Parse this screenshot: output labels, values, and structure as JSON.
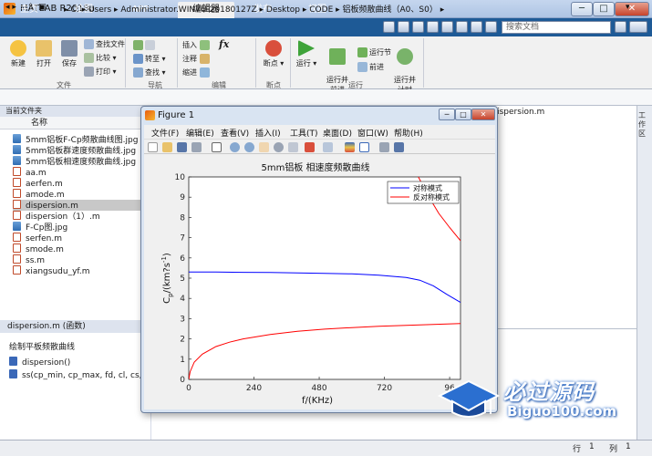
{
  "app": {
    "title": "MATLAB R2018a",
    "window_controls": {
      "minimize": "─",
      "maximize": "□",
      "close": "✕"
    }
  },
  "tabs": [
    "主页",
    "绘图",
    "APP",
    "编辑器",
    "发布",
    "视图"
  ],
  "active_tab": "编辑器",
  "search": {
    "placeholder": "搜索文档"
  },
  "ribbon": {
    "file_group": {
      "label": "文件",
      "new": "新建",
      "open": "打开",
      "save": "保存",
      "find_files": "查找文件",
      "compare": "比较",
      "print": "打印"
    },
    "nav_group": {
      "label": "导航",
      "goto": "转至",
      "find": "查找"
    },
    "edit_group": {
      "label": "编辑",
      "insert": "插入",
      "comment": "注释",
      "indent": "缩进",
      "fx": "fx"
    },
    "breakpoint_group": {
      "label": "断点",
      "breakpoints": "断点"
    },
    "run_group": {
      "label": "运行",
      "run": "运行",
      "run_advance": "运行并\n前进",
      "run_section": "运行节",
      "advance": "前进",
      "run_time": "运行并\n计时"
    }
  },
  "address": {
    "parts": [
      "C:",
      "Users",
      "Administrator.WIN7U-20180127Z",
      "Desktop",
      "CODE",
      "铝板频散曲线（A0、S0）"
    ]
  },
  "current_folder": {
    "header": "当前文件夹",
    "column": "名称",
    "files": [
      {
        "name": "5mm铝板F-Cp频散曲线图.jpg",
        "type": "jpg"
      },
      {
        "name": "5mm铝板群速度频散曲线.jpg",
        "type": "jpg"
      },
      {
        "name": "5mm铝板相速度频散曲线.jpg",
        "type": "jpg"
      },
      {
        "name": "aa.m",
        "type": "m"
      },
      {
        "name": "aerfen.m",
        "type": "m"
      },
      {
        "name": "amode.m",
        "type": "m"
      },
      {
        "name": "dispersion.m",
        "type": "m",
        "selected": true
      },
      {
        "name": "dispersion（1）.m",
        "type": "m"
      },
      {
        "name": "F-Cp图.jpg",
        "type": "jpg"
      },
      {
        "name": "serfen.m",
        "type": "m"
      },
      {
        "name": "smode.m",
        "type": "m"
      },
      {
        "name": "ss.m",
        "type": "m"
      },
      {
        "name": "xiangsudu_yf.m",
        "type": "m"
      }
    ]
  },
  "details": {
    "header": "dispersion.m  (函数)",
    "description": "绘制平板频散曲线",
    "functions": [
      "dispersion()",
      "ss(cp_min, cp_max, fd, cl, cs, mo"
    ]
  },
  "editor": {
    "tab_title": ") \\dispersion.m"
  },
  "right_strip": {
    "label": "工作区"
  },
  "statusbar": {
    "ln_label": "行",
    "ln_value": "1",
    "col_label": "列",
    "col_value": "1"
  },
  "figure": {
    "title": "Figure 1",
    "menus": [
      "文件(F)",
      "编辑(E)",
      "查看(V)",
      "插入(I)",
      "工具(T)",
      "桌面(D)",
      "窗口(W)",
      "帮助(H)"
    ],
    "toolbar_icons": [
      "new-figure-icon",
      "open-icon",
      "save-icon",
      "print-icon",
      "pointer-icon",
      "zoom-in-icon",
      "zoom-out-icon",
      "pan-icon",
      "rotate-icon",
      "datatip-icon",
      "brush-icon",
      "link-icon",
      "colorbar-icon",
      "legend-icon",
      "hide-tools-icon",
      "dock-icon"
    ]
  },
  "chart_data": {
    "type": "line",
    "title": "5mm铝板 相速度频散曲线",
    "xlabel": "f/(KHz)",
    "ylabel_base": "C",
    "ylabel_sub": "p",
    "ylabel_units": "/(km?s",
    "ylabel_sup": "-1",
    "ylabel_close": ")",
    "xlim": [
      0,
      1000
    ],
    "ylim": [
      0,
      10
    ],
    "xticks": [
      0,
      240,
      480,
      720,
      960
    ],
    "xtick_labels": [
      "0",
      "240",
      "480",
      "720",
      "96"
    ],
    "yticks": [
      0,
      1,
      2,
      3,
      4,
      5,
      6,
      7,
      8,
      9,
      10
    ],
    "legend": [
      "对称模式",
      "反对称模式"
    ],
    "legend_position": "top-right",
    "series": [
      {
        "name": "对称模式",
        "color": "#0000ff",
        "x": [
          0,
          100,
          200,
          300,
          400,
          500,
          600,
          700,
          800,
          850,
          900,
          950,
          1000
        ],
        "y": [
          5.3,
          5.3,
          5.29,
          5.28,
          5.26,
          5.24,
          5.21,
          5.15,
          5.03,
          4.9,
          4.62,
          4.2,
          3.8
        ]
      },
      {
        "name": "反对称模式",
        "color": "#ff0000",
        "x": [
          0,
          5,
          20,
          50,
          100,
          150,
          200,
          300,
          400,
          500,
          600,
          700,
          800,
          900,
          1000
        ],
        "y": [
          0,
          0.38,
          0.85,
          1.25,
          1.62,
          1.84,
          2.0,
          2.22,
          2.38,
          2.48,
          2.56,
          2.62,
          2.67,
          2.71,
          2.76
        ]
      },
      {
        "name": "",
        "color": "#ff0000",
        "x": [
          845,
          880,
          920,
          960,
          1000
        ],
        "y": [
          10,
          9.1,
          8.2,
          7.5,
          6.85
        ]
      }
    ]
  },
  "watermark": {
    "line1": "必过源码",
    "line2": "Biguo100.com"
  }
}
